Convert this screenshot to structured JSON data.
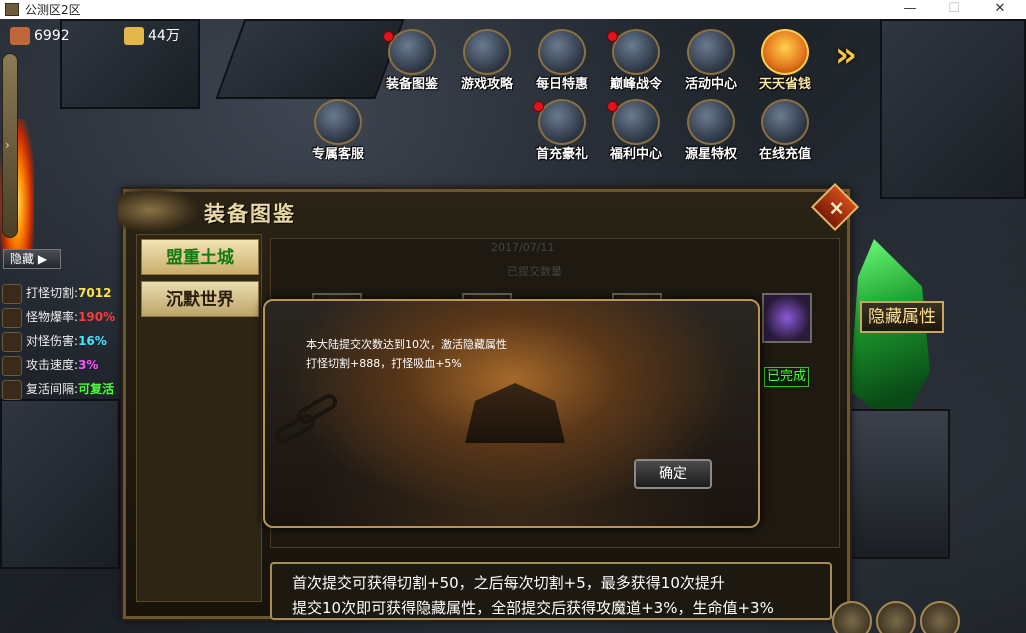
{
  "window": {
    "title": "公测区2区",
    "minimize": "—",
    "maximize": "☐",
    "close": "✕"
  },
  "resources": [
    {
      "name": "ingot",
      "value": "6992",
      "color": "#c0663a"
    },
    {
      "name": "gold",
      "value": "44万",
      "color": "#e2b84a"
    }
  ],
  "sidebar": {
    "toggle_glyph": "›",
    "hide_label": "隐藏 ▶"
  },
  "stats": [
    {
      "label": "打怪切割",
      "value": "7012",
      "value_color": "#ffe14a"
    },
    {
      "label": "怪物爆率",
      "value": "190%",
      "value_color": "#ff3a3a"
    },
    {
      "label": "对怪伤害",
      "value": "16%",
      "value_color": "#44e6ff"
    },
    {
      "label": "攻击速度",
      "value": "3%",
      "value_color": "#ff52ff"
    },
    {
      "label": "复活间隔",
      "value": "可复活",
      "value_color": "#4dff3b"
    }
  ],
  "features_row1": [
    {
      "label": "装备图鉴",
      "badge": true
    },
    {
      "label": "游戏攻略",
      "badge": false
    },
    {
      "label": "每日特惠",
      "badge": false
    },
    {
      "label": "巅峰战令",
      "badge": true
    },
    {
      "label": "活动中心",
      "badge": false
    },
    {
      "label": "天天省钱",
      "badge": false
    }
  ],
  "features_row2": [
    {
      "label": "专属客服",
      "badge": false
    },
    {
      "label": "首充豪礼",
      "badge": true
    },
    {
      "label": "福利中心",
      "badge": true
    },
    {
      "label": "源星特权",
      "badge": false
    },
    {
      "label": "在线充值",
      "badge": false
    }
  ],
  "expand_glyph": "»",
  "panel": {
    "title": "装备图鉴",
    "close_glyph": "×",
    "categories": [
      {
        "label": "盟重土城",
        "active": true
      },
      {
        "label": "沉默世界",
        "active": false
      }
    ],
    "faint_text": [
      "2017/07/11",
      "已提交数量"
    ],
    "done_badge": "已完成",
    "description": [
      "首次提交可获得切割+50，之后每次切割+5，最多获得10次提升",
      "提交10次即可获得隐藏属性，全部提交后获得攻魔道+3%，生命值+3%"
    ]
  },
  "hidden_attr_label": "隐藏属性",
  "dialog": {
    "lines": [
      "本大陆提交次数达到10次，激活隐藏属性",
      "打怪切割+888，打怪吸血+5%"
    ],
    "confirm_label": "确定"
  }
}
